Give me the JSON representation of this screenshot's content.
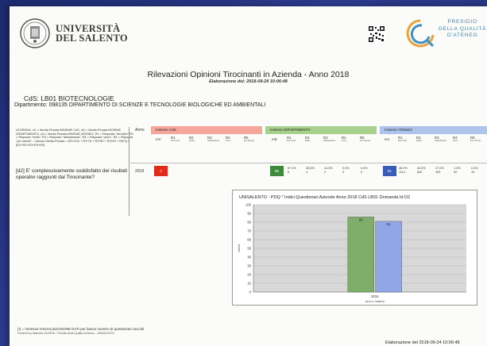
{
  "header": {
    "university_line1": "UNIVERSITÀ",
    "university_line2": "DEL SALENTO",
    "presidio_line1": "PRESIDIO",
    "presidio_line2": "DELLA QUALITÀ",
    "presidio_line3": "D'ATENEO"
  },
  "document": {
    "title": "Rilevazioni Opinioni Tirocinanti in Azienda - Anno 2018",
    "subtitle": "Elaborazione del: 2018-09-24 10:06:48",
    "cds": "CdS: LB01 BIOTECNOLOGIE",
    "dipartimento": "Dipartimento: 098135 DIPARTIMENTO DI SCIENZE E TECNOLOGIE BIOLOGICHE ED AMBIENTALI"
  },
  "table": {
    "legend": "LEGENDA: nC = Media Pesata INSIEME CdS, nD = Media Pesata INSIEME DIPARTIMENTO, nA = Media Pesata INSIEME ATENEO; R1 = Risposta \"del tutto\" R2 = Risposta \"molto\" R3 = Risposta \"abbastanza\", R4 = Risposta \"poco\", R5 = Risposta \"per niente\" ; Calcolo Media Pesata = (R1*100 + R2*75 + R3*50 + R4*25 + R5*0) / (R1+R2+R3+R4+R5)",
    "question": "[d2] E' complessivamente soddisfatto dei risultati operativi raggiunti dal Tirocinante?",
    "anno_header": "Anno",
    "year": "2018",
    "groups": [
      {
        "label": "Insieme CdS",
        "color": "#f4a79a"
      },
      {
        "label": "Insieme DIPARTIMENTO",
        "color": "#a9d18e"
      },
      {
        "label": "Insieme ATENEO",
        "color": "#aec4ea"
      }
    ],
    "cds_cols": {
      "n": "mC",
      "cols": [
        {
          "h": "R1",
          "l": "Del Tutto"
        },
        {
          "h": "R2",
          "l": "Molto"
        },
        {
          "h": "R3",
          "l": "Abbastanza"
        },
        {
          "h": "R4",
          "l": "Poco"
        },
        {
          "h": "R5",
          "l": "Per Niente"
        }
      ]
    },
    "dip_cols": {
      "n": "mD",
      "cols": [
        {
          "h": "R1",
          "l": "Del Tutto"
        },
        {
          "h": "R2",
          "l": "Molto"
        },
        {
          "h": "R3",
          "l": "Abbastanza"
        },
        {
          "h": "R4",
          "l": "Poco"
        },
        {
          "h": "R5",
          "l": "Per Niente"
        }
      ]
    },
    "ateneo_cols": {
      "n": "mA",
      "cols": [
        {
          "h": "R1",
          "l": "Del Tutto"
        },
        {
          "h": "R2",
          "l": "Molto"
        },
        {
          "h": "R3",
          "l": "Abbastanza"
        },
        {
          "h": "R4",
          "l": "Poco"
        },
        {
          "h": "R5",
          "l": "Per Niente"
        }
      ]
    },
    "row": {
      "cds_n": "0",
      "dip_n": "86",
      "dip_vals": [
        [
          "57.1%",
          "8"
        ],
        [
          "28.6%",
          "4"
        ],
        [
          "14.3%",
          "2"
        ],
        [
          "0.0%",
          "0"
        ],
        [
          "0.0%",
          "0"
        ]
      ],
      "ateneo_n": "81",
      "ateneo_vals": [
        [
          "46.2%",
          "1114"
        ],
        [
          "34.5%",
          "832"
        ],
        [
          "17.0%",
          "409"
        ],
        [
          "1.3%",
          "32"
        ],
        [
          "0.4%",
          "10"
        ]
      ]
    }
  },
  "chart_data": {
    "type": "bar",
    "title": "UNISALENTO - PDQ * Indici Questionari Aziende Anno 2018 CdS LB01 Domanda Id D2",
    "categories": [
      "2018"
    ],
    "series": [
      {
        "name": "",
        "values": [
          86
        ],
        "color": "#7fae6b"
      },
      {
        "name": "",
        "values": [
          81
        ],
        "color": "#8fa7e6"
      }
    ],
    "bar_labels": [
      "86",
      "81"
    ],
    "ylabel": "Valori",
    "xlabel": "Anni e Insiemi",
    "ylim": [
      0,
      100
    ],
    "yticks": [
      "0",
      "10",
      "20",
      "30",
      "40",
      "50",
      "60",
      "70",
      "80",
      "90",
      "100"
    ],
    "grid": true
  },
  "footer": {
    "note": "(I) = Omessa VISUALIZZAZIONE DATI per basso numero di questionari raccolti.",
    "credit": "Powered by Massimo GUARTA - Presidio della Qualità di Ateneo - UNISALENTO",
    "elaborazione": "Elaborazione del 2018-09-24 10:06:48"
  }
}
